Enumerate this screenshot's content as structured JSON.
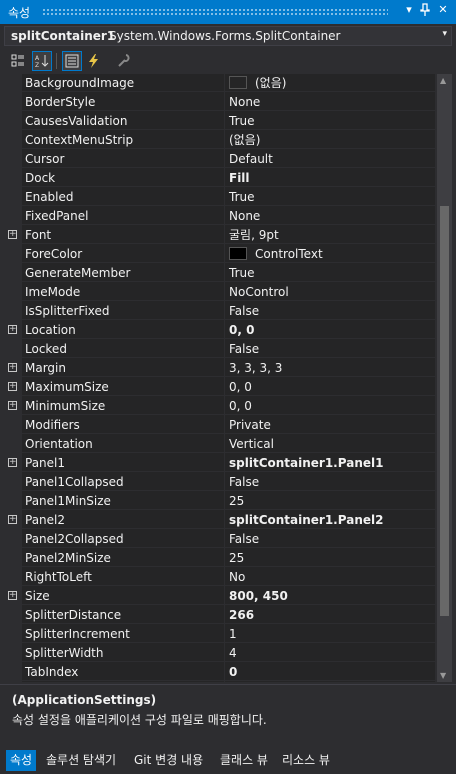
{
  "window": {
    "title": "속성",
    "dropdown_glyph": "▾",
    "pin_glyph": "ᵖ",
    "close_glyph": "✕"
  },
  "object_selector": {
    "name": "splitContainer1",
    "type": "System.Windows.Forms.SplitContainer",
    "arrow": "▾"
  },
  "toolbar": {
    "buttons": [
      {
        "icon": "categorized-icon",
        "glyph": "▦",
        "active": false
      },
      {
        "icon": "alphabetical-icon",
        "glyph": "↓",
        "active": true
      },
      {
        "icon": "properties-icon",
        "glyph": "▤",
        "active": true
      },
      {
        "icon": "events-icon",
        "glyph": "⚡",
        "active": false
      },
      {
        "icon": "property-pages-icon",
        "glyph": "🔧",
        "active": false
      }
    ]
  },
  "properties": [
    {
      "name": "BackgroundImage",
      "value": "(없음)",
      "swatch": "#252526"
    },
    {
      "name": "BorderStyle",
      "value": "None"
    },
    {
      "name": "CausesValidation",
      "value": "True"
    },
    {
      "name": "ContextMenuStrip",
      "value": "(없음)"
    },
    {
      "name": "Cursor",
      "value": "Default"
    },
    {
      "name": "Dock",
      "value": "Fill",
      "bold": true
    },
    {
      "name": "Enabled",
      "value": "True"
    },
    {
      "name": "FixedPanel",
      "value": "None"
    },
    {
      "name": "Font",
      "value": "굴림, 9pt",
      "expand": true
    },
    {
      "name": "ForeColor",
      "value": "ControlText",
      "swatch": "#000000"
    },
    {
      "name": "GenerateMember",
      "value": "True"
    },
    {
      "name": "ImeMode",
      "value": "NoControl"
    },
    {
      "name": "IsSplitterFixed",
      "value": "False"
    },
    {
      "name": "Location",
      "value": "0, 0",
      "bold": true,
      "expand": true
    },
    {
      "name": "Locked",
      "value": "False"
    },
    {
      "name": "Margin",
      "value": "3, 3, 3, 3",
      "expand": true
    },
    {
      "name": "MaximumSize",
      "value": "0, 0",
      "expand": true
    },
    {
      "name": "MinimumSize",
      "value": "0, 0",
      "expand": true
    },
    {
      "name": "Modifiers",
      "value": "Private"
    },
    {
      "name": "Orientation",
      "value": "Vertical"
    },
    {
      "name": "Panel1",
      "value": "splitContainer1.Panel1",
      "bold": true,
      "expand": true
    },
    {
      "name": "Panel1Collapsed",
      "value": "False"
    },
    {
      "name": "Panel1MinSize",
      "value": "25"
    },
    {
      "name": "Panel2",
      "value": "splitContainer1.Panel2",
      "bold": true,
      "expand": true
    },
    {
      "name": "Panel2Collapsed",
      "value": "False"
    },
    {
      "name": "Panel2MinSize",
      "value": "25"
    },
    {
      "name": "RightToLeft",
      "value": "No"
    },
    {
      "name": "Size",
      "value": "800, 450",
      "bold": true,
      "expand": true
    },
    {
      "name": "SplitterDistance",
      "value": "266",
      "bold": true
    },
    {
      "name": "SplitterIncrement",
      "value": "1"
    },
    {
      "name": "SplitterWidth",
      "value": "4"
    },
    {
      "name": "TabIndex",
      "value": "0",
      "bold": true
    }
  ],
  "expand_glyph": "+",
  "scrollbar": {
    "up": "▲",
    "down": "▼"
  },
  "description": {
    "title": "(ApplicationSettings)",
    "text": "속성 설정을 애플리케이션 구성 파일로 매핑합니다."
  },
  "tabs": [
    {
      "label": "속성",
      "active": true
    },
    {
      "label": "솔루션 탐색기",
      "active": false
    },
    {
      "label": "Git 변경 내용",
      "active": false
    },
    {
      "label": "클래스 뷰",
      "active": false
    },
    {
      "label": "리소스 뷰",
      "active": false
    }
  ],
  "colors": {
    "accent": "#007acc",
    "background": "#2d2d30",
    "grid": "#252526"
  }
}
